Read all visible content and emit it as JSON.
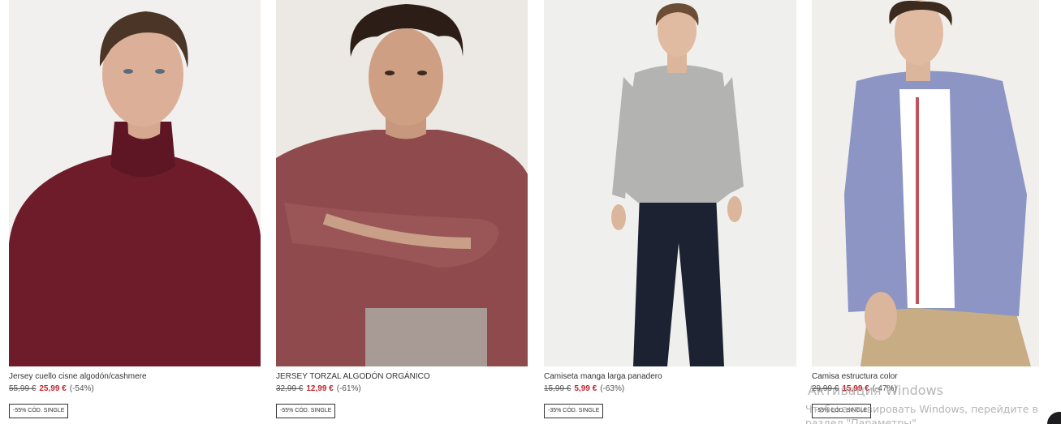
{
  "products": [
    {
      "name": "Jersey cuello cisne algodón/cashmere",
      "old_price": "55,99 €",
      "new_price": "25,99 €",
      "discount": "(-54%)",
      "badge": "-55% CÓD. SINGLE",
      "colors": {
        "bg": "#f1f0ee",
        "garment": "#6e1c2a"
      }
    },
    {
      "name": "JERSEY TORZAL ALGODÓN ORGÁNICO",
      "old_price": "32,99 €",
      "new_price": "12,99 €",
      "discount": "(-61%)",
      "badge": "-55% CÓD. SINGLE",
      "colors": {
        "bg": "#ece9e4",
        "garment": "#8e4a4c"
      }
    },
    {
      "name": "Camiseta manga larga panadero",
      "old_price": "15,99 €",
      "new_price": "5,99 €",
      "discount": "(-63%)",
      "badge": "-35% CÓD. SINGLE",
      "colors": {
        "bg": "#efefed",
        "garment": "#b3b3b1",
        "trousers": "#1c2232"
      }
    },
    {
      "name": "Camisa estructura color",
      "old_price": "29,99 €",
      "new_price": "15,99 €",
      "discount": "(-47%)",
      "badge": "-55% CÓD. SINGLE",
      "colors": {
        "bg": "#f0efec",
        "garment": "#8c95c4",
        "trousers": "#c7ac84"
      }
    }
  ],
  "watermark": {
    "title": "Активация Windows",
    "line1": "Чтобы активировать Windows, перейдите в",
    "line2": "раздел \"Параметры\"."
  }
}
